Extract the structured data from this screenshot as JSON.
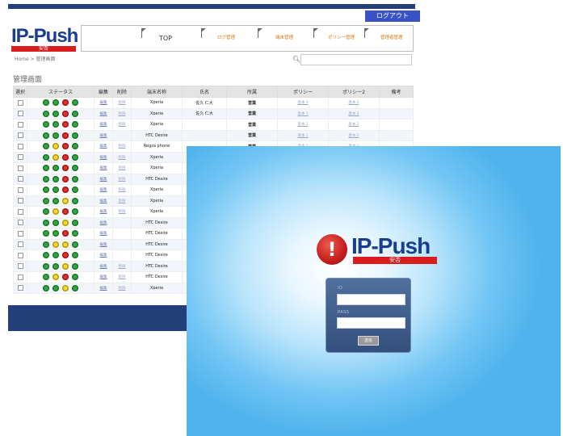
{
  "admin": {
    "logout_label": "ログアウト",
    "logo_text": "IP-Push",
    "logo_sub": "安否",
    "nav": [
      {
        "label": "TOP"
      },
      {
        "label": "ログ管理"
      },
      {
        "label": "端末管理"
      },
      {
        "label": "ポリシー管理"
      },
      {
        "label": "管理者管理"
      }
    ],
    "breadcrumb": "Home  >  管理画面",
    "search_placeholder": "",
    "section_title": "管理画面",
    "columns": [
      "選択",
      "ステータス",
      "編集",
      "削除",
      "端末名称",
      "氏名",
      "所属",
      "ポリシー",
      "ポリシー2",
      "備考"
    ],
    "rows": [
      {
        "status": [
          "g",
          "g",
          "r",
          "g"
        ],
        "edit": "編集",
        "del": "削除",
        "device": "Xperia",
        "name": "佐久 仁大",
        "dept": "営業",
        "policy": "基本 1",
        "policy2": "基本 2"
      },
      {
        "status": [
          "g",
          "g",
          "r",
          "g"
        ],
        "edit": "編集",
        "del": "削除",
        "device": "Xperia",
        "name": "佐久 仁大",
        "dept": "営業",
        "policy": "基本 1",
        "policy2": "基本 2"
      },
      {
        "status": [
          "g",
          "g",
          "r",
          "g"
        ],
        "edit": "編集",
        "del": "削除",
        "device": "Xperia",
        "name": "",
        "dept": "営業",
        "policy": "基本 1",
        "policy2": "基本 2"
      },
      {
        "status": [
          "g",
          "g",
          "r",
          "g"
        ],
        "edit": "編集",
        "del": "",
        "device": "HTC Desire",
        "name": "",
        "dept": "営業",
        "policy": "基本 1",
        "policy2": "基本 2"
      },
      {
        "status": [
          "g",
          "y",
          "r",
          "g"
        ],
        "edit": "編集",
        "del": "削除",
        "device": "Regza phone",
        "name": "",
        "dept": "営業",
        "policy": "基本 1",
        "policy2": "基本 2"
      },
      {
        "status": [
          "g",
          "y",
          "r",
          "g"
        ],
        "edit": "編集",
        "del": "削除",
        "device": "Xperia",
        "name": "",
        "dept": "",
        "policy": "",
        "policy2": ""
      },
      {
        "status": [
          "g",
          "g",
          "r",
          "g"
        ],
        "edit": "編集",
        "del": "削除",
        "device": "Xperia",
        "name": "",
        "dept": "",
        "policy": "",
        "policy2": ""
      },
      {
        "status": [
          "g",
          "g",
          "r",
          "g"
        ],
        "edit": "編集",
        "del": "削除",
        "device": "HTC Desire",
        "name": "",
        "dept": "",
        "policy": "",
        "policy2": ""
      },
      {
        "status": [
          "g",
          "g",
          "r",
          "g"
        ],
        "edit": "編集",
        "del": "削除",
        "device": "Xperia",
        "name": "",
        "dept": "",
        "policy": "",
        "policy2": ""
      },
      {
        "status": [
          "g",
          "g",
          "y",
          "g"
        ],
        "edit": "編集",
        "del": "削除",
        "device": "Xperia",
        "name": "",
        "dept": "",
        "policy": "",
        "policy2": ""
      },
      {
        "status": [
          "g",
          "y",
          "r",
          "g"
        ],
        "edit": "編集",
        "del": "削除",
        "device": "Xperia",
        "name": "",
        "dept": "",
        "policy": "",
        "policy2": ""
      },
      {
        "status": [
          "g",
          "g",
          "y",
          "g"
        ],
        "edit": "編集",
        "del": "",
        "device": "HTC Desire",
        "name": "",
        "dept": "",
        "policy": "",
        "policy2": ""
      },
      {
        "status": [
          "g",
          "g",
          "r",
          "g"
        ],
        "edit": "編集",
        "del": "",
        "device": "HTC Desire",
        "name": "",
        "dept": "",
        "policy": "",
        "policy2": ""
      },
      {
        "status": [
          "g",
          "y",
          "y",
          "g"
        ],
        "edit": "編集",
        "del": "",
        "device": "HTC Desire",
        "name": "",
        "dept": "",
        "policy": "",
        "policy2": ""
      },
      {
        "status": [
          "g",
          "g",
          "r",
          "g"
        ],
        "edit": "編集",
        "del": "",
        "device": "HTC Desire",
        "name": "",
        "dept": "",
        "policy": "",
        "policy2": ""
      },
      {
        "status": [
          "g",
          "g",
          "y",
          "g"
        ],
        "edit": "編集",
        "del": "削除",
        "device": "HTC Desire",
        "name": "",
        "dept": "",
        "policy": "",
        "policy2": ""
      },
      {
        "status": [
          "g",
          "y",
          "r",
          "g"
        ],
        "edit": "編集",
        "del": "削除",
        "device": "HTC Desire",
        "name": "",
        "dept": "",
        "policy": "",
        "policy2": ""
      },
      {
        "status": [
          "g",
          "g",
          "y",
          "g"
        ],
        "edit": "編集",
        "del": "削除",
        "device": "Xperia",
        "name": "",
        "dept": "",
        "policy": "",
        "policy2": ""
      }
    ],
    "colors": {
      "header_bar": "#23407a",
      "logout_bg": "#3b52c7",
      "nav_orange": "#e07a1a"
    }
  },
  "login": {
    "logo_text": "IP-Push",
    "logo_sub": "安否",
    "logo_icon": "exclamation-icon",
    "id_label": "ID",
    "pass_label": "PASS",
    "id_value": "",
    "pass_value": "",
    "button_label": "送信"
  }
}
